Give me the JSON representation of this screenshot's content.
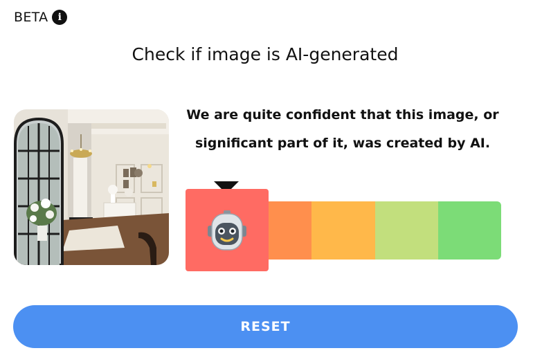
{
  "header": {
    "badge_label": "BETA",
    "info_icon": "info-icon"
  },
  "title": "Check if image is AI-generated",
  "result": {
    "message_line1": "We are quite confident that this image, or",
    "message_line2": "significant part of it, was created by AI.",
    "meter_level": 1,
    "meter_segments": 5,
    "indicator_icon": "robot-icon"
  },
  "colors": {
    "segments": [
      "#ff6b63",
      "#ff8f4d",
      "#ffb84a",
      "#c2df7d",
      "#7cdc77"
    ],
    "button": "#4c90f2"
  },
  "actions": {
    "reset_label": "RESET"
  }
}
